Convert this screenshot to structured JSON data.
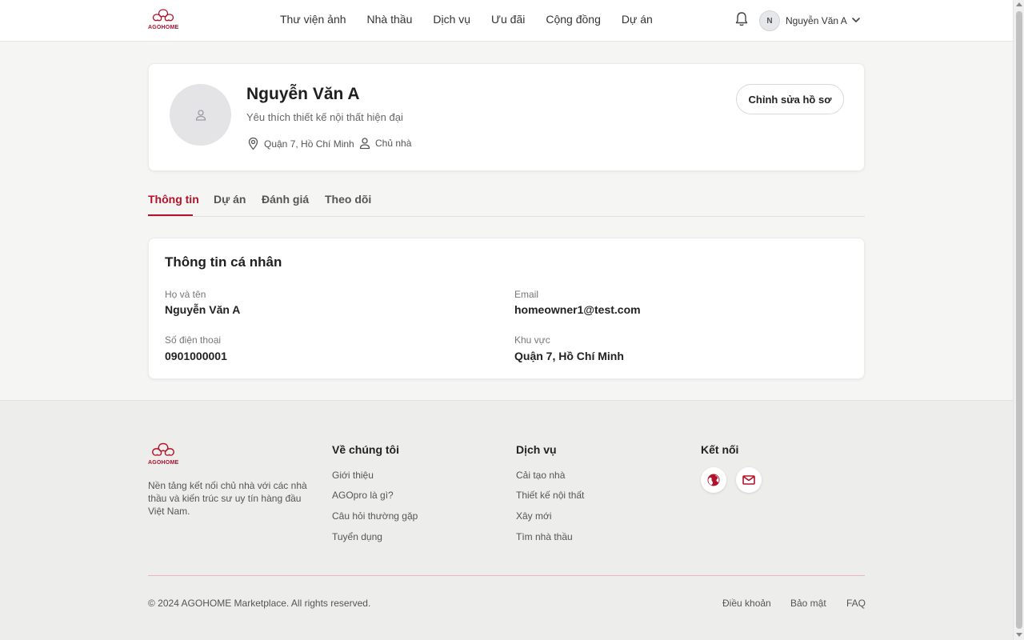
{
  "brand": {
    "name": "AGOHOME",
    "accent_color": "#b3122a"
  },
  "header": {
    "nav": [
      "Thư viện ảnh",
      "Nhà thầu",
      "Dịch vụ",
      "Ưu đãi",
      "Cộng đồng",
      "Dự án"
    ],
    "notification_icon": "bell-icon",
    "user": {
      "initial": "N",
      "name": "Nguyễn Văn A",
      "dropdown_icon": "chevron-down-icon"
    }
  },
  "profile": {
    "name": "Nguyễn Văn A",
    "bio": "Yêu thích thiết kế nội thất hiện đại",
    "location": "Quận 7, Hồ Chí Minh",
    "role": "Chủ nhà",
    "edit_label": "Chỉnh sửa hồ sơ"
  },
  "tabs": {
    "items": [
      "Thông tin",
      "Dự án",
      "Đánh giá",
      "Theo dõi"
    ],
    "active": "Thông tin"
  },
  "personal_info": {
    "title": "Thông tin cá nhân",
    "fields": [
      {
        "label": "Họ và tên",
        "value": "Nguyễn Văn A"
      },
      {
        "label": "Email",
        "value": "homeowner1@test.com"
      },
      {
        "label": "Số điện thoại",
        "value": "0901000001"
      },
      {
        "label": "Khu vực",
        "value": "Quận 7, Hồ Chí Minh"
      }
    ]
  },
  "footer": {
    "description": "Nền tảng kết nối chủ nhà với các nhà thầu và kiến trúc sư uy tín hàng đầu Việt Nam.",
    "columns": [
      {
        "title": "Về chúng tôi",
        "links": [
          "Giới thiệu",
          "AGOpro là gì?",
          "Câu hỏi thường gặp",
          "Tuyển dụng"
        ]
      },
      {
        "title": "Dịch vụ",
        "links": [
          "Cải tạo nhà",
          "Thiết kế nội thất",
          "Xây mới",
          "Tìm nhà thầu"
        ]
      },
      {
        "title": "Kết nối",
        "icons": [
          "globe-icon",
          "mail-icon"
        ]
      }
    ],
    "copyright": "© 2024 AGOHOME Marketplace. All rights reserved.",
    "legal_links": [
      "Điều khoản",
      "Bảo mật",
      "FAQ"
    ]
  }
}
